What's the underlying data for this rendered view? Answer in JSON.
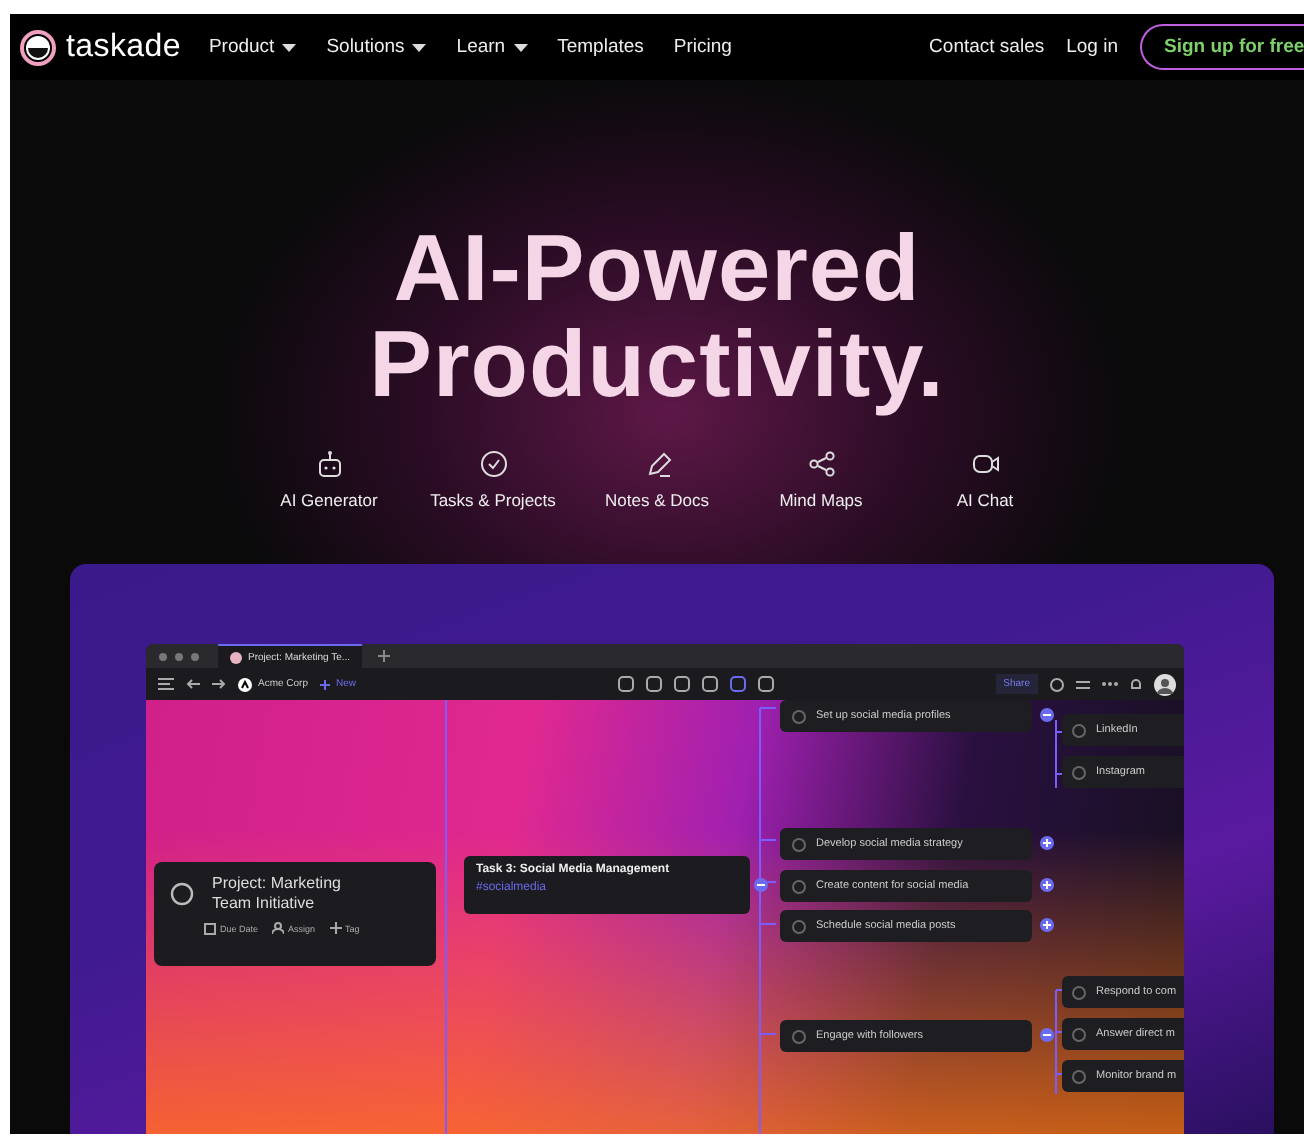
{
  "nav": {
    "brand": "taskade",
    "items": [
      {
        "label": "Product",
        "dropdown": true
      },
      {
        "label": "Solutions",
        "dropdown": true
      },
      {
        "label": "Learn",
        "dropdown": true
      },
      {
        "label": "Templates",
        "dropdown": false
      },
      {
        "label": "Pricing",
        "dropdown": false
      }
    ],
    "right_links": [
      "Contact sales",
      "Log in"
    ],
    "cta": "Sign up for free"
  },
  "hero": {
    "title_lines": [
      "AI-Powered",
      "Productivity."
    ],
    "features": [
      "AI Generator",
      "Tasks & Projects",
      "Notes & Docs",
      "Mind Maps",
      "AI Chat"
    ]
  },
  "app": {
    "tab_title": "Project: Marketing Te...",
    "workspace": "Acme Corp",
    "new_label": "New",
    "share": "Share",
    "view_icons": [
      {
        "selected": false
      },
      {
        "selected": false
      },
      {
        "selected": false
      },
      {
        "selected": false
      },
      {
        "selected": true
      },
      {
        "selected": false
      }
    ],
    "project": {
      "title": "Project: Marketing Team Initiative",
      "meta": [
        "Due Date",
        "Assign",
        "Tag"
      ]
    },
    "task": {
      "title": "Task 3: Social Media Management",
      "tag": "#socialmedia",
      "children": [
        {
          "label": "Set up social media profiles",
          "children": [
            {
              "label": "LinkedIn"
            },
            {
              "label": "Instagram"
            }
          ]
        },
        {
          "label": "Develop social media strategy"
        },
        {
          "label": "Create content for social media"
        },
        {
          "label": "Schedule social media posts"
        },
        {
          "label": "Engage with followers",
          "children": [
            {
              "label": "Respond to com"
            },
            {
              "label": "Answer direct m"
            },
            {
              "label": "Monitor brand m"
            }
          ]
        }
      ]
    }
  }
}
